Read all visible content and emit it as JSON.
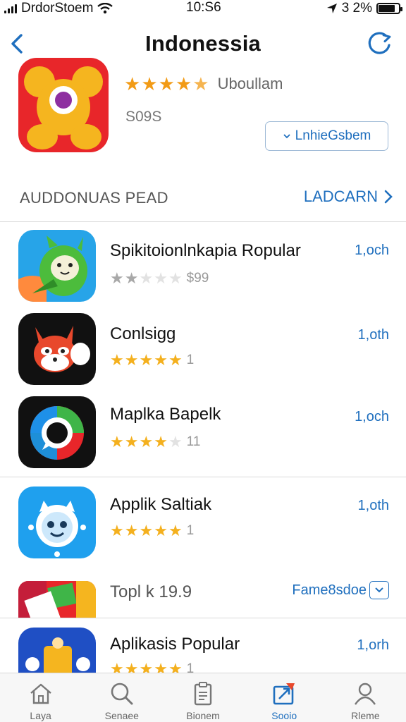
{
  "status_bar": {
    "carrier": "DrdorStoem",
    "time": "10:S6",
    "battery": "3 2%",
    "battery_level": 0.82
  },
  "header": {
    "title": "Indonessia",
    "back_icon": "chevron-left-icon",
    "refresh_icon": "refresh-icon"
  },
  "featured": {
    "rating_text": "Uboullam",
    "rating": 4.5,
    "price": "S09S",
    "button_label": "LnhieGsbem",
    "icon_colors": {
      "bg": "#e8262a",
      "face": "#f5b51f",
      "eye": "#8e2fa0"
    }
  },
  "section": {
    "title": "AUDDONUAS PEAD",
    "link_label": "LADCARN"
  },
  "apps": [
    {
      "name": "Spikitoionlnkapia Ropular",
      "size": "1,och",
      "rating": 2,
      "rating_color": "gray",
      "count": "$99"
    },
    {
      "name": "Conlsigg",
      "size": "1,oth",
      "rating": 5,
      "count": "1"
    },
    {
      "name": "Maplka Bapelk",
      "size": "1,och",
      "rating": 4,
      "count": "11"
    },
    {
      "name": "Applik Saltiak",
      "size": "1,oth",
      "rating": 5,
      "count": "1"
    },
    {
      "name": "Topl k 19.9",
      "action_label": "Fame8sdoe"
    },
    {
      "name": "Aplikasis Popular",
      "size": "1,orh",
      "rating": 5,
      "count": "1"
    }
  ],
  "tabbar": {
    "tabs": [
      {
        "label": "Laya",
        "icon": "home-icon"
      },
      {
        "label": "Senaee",
        "icon": "search-icon"
      },
      {
        "label": "Bionem",
        "icon": "document-icon"
      },
      {
        "label": "Sooio",
        "icon": "updates-icon",
        "active": true
      },
      {
        "label": "Rleme",
        "icon": "person-icon"
      }
    ]
  }
}
